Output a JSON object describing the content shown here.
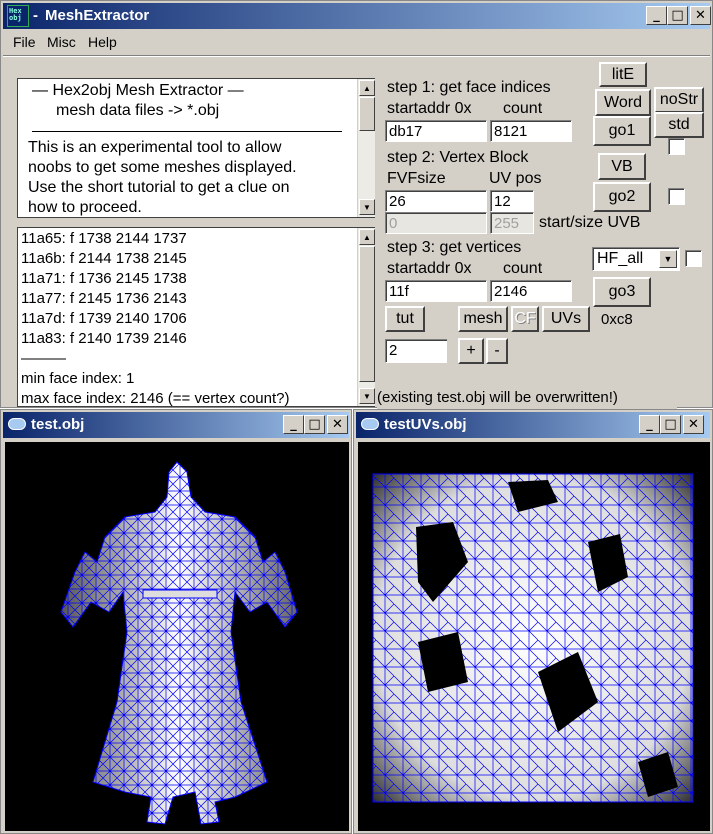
{
  "window": {
    "title": "MeshExtractor",
    "icon_text": [
      "He",
      "x",
      "obj"
    ]
  },
  "menu": [
    {
      "label": "File"
    },
    {
      "label": "Misc"
    },
    {
      "label": "Help"
    }
  ],
  "info_text": [
    "—   Hex2obj Mesh Extractor   —",
    "mesh data files -> *.obj",
    "This is an experimental tool to allow",
    "noobs to get some meshes displayed.",
    "Use the short tutorial to get a clue on",
    "how to proceed."
  ],
  "log_lines": [
    "11a65: f  1738 2144 1737",
    "11a6b: f  2144 1738 2145",
    "11a71: f  1736 2145 1738",
    "11a77: f  2145 1736 2143",
    "11a7d: f  1739 2140 1706",
    "11a83: f  2140 1739 2146",
    "———",
    "min face index: 1",
    "max face index: 2146 (== vertex count?)"
  ],
  "step1": {
    "title": "step 1: get face indices",
    "addr_label": "startaddr 0x",
    "count_label": "count",
    "addr": "db17",
    "count": "8121"
  },
  "step2": {
    "title": "step 2: Vertex Block",
    "fvf_label": "FVFsize",
    "uv_label": "UV pos",
    "fvf": "26",
    "uv": "12",
    "uvb_start": "0",
    "uvb_size": "255",
    "uvb_label": "start/size UVB"
  },
  "step3": {
    "title": "step 3: get vertices",
    "addr_label": "startaddr 0x",
    "count_label": "count",
    "addr": "11f",
    "count": "2146",
    "hint": "(existing test.obj will be overwritten!)"
  },
  "buttons": {
    "lite": "litE",
    "word": "Word",
    "nostr": "noStr",
    "std": "std",
    "go1": "go1",
    "vb": "VB",
    "go2": "go2",
    "go3": "go3",
    "tut": "tut",
    "mesh": "mesh",
    "cf": "CF",
    "uvs": "UVs",
    "plus": "+",
    "minus": "-"
  },
  "select": {
    "value": "HF_all"
  },
  "readout": "0xc8",
  "stepper_value": "2",
  "subwindows": [
    {
      "title": "test.obj"
    },
    {
      "title": "testUVs.obj"
    }
  ],
  "title_buttons": {
    "minimize": "_",
    "maximize": "□",
    "close": "✕"
  },
  "colors": {
    "mesh_wire": "#0000ff",
    "viewport_bg": "#000000",
    "dialog": "#d4d0c8"
  }
}
